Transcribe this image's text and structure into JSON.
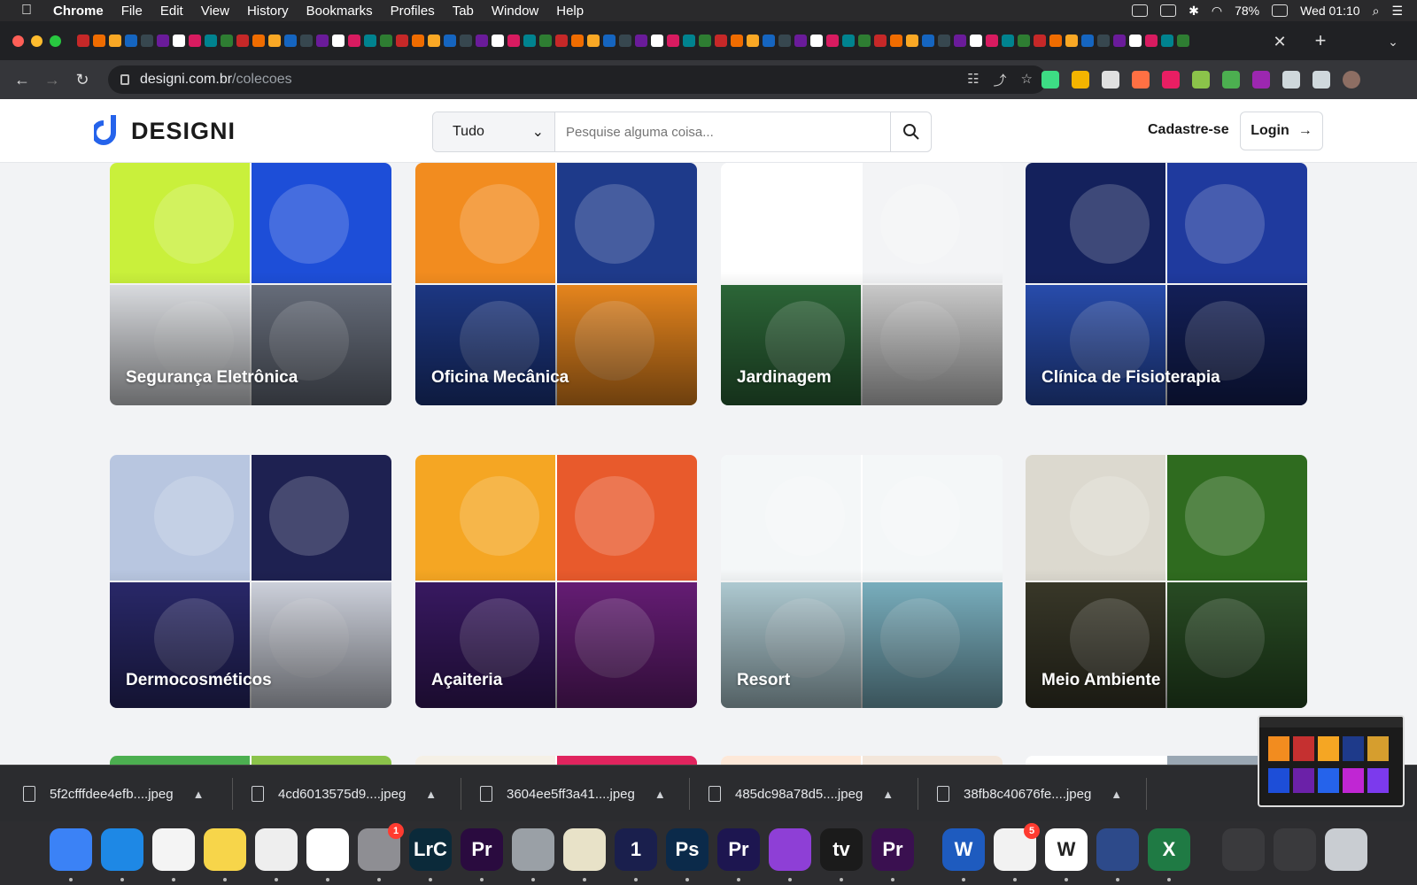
{
  "menubar": {
    "app": "Chrome",
    "items": [
      "File",
      "Edit",
      "View",
      "History",
      "Bookmarks",
      "Profiles",
      "Tab",
      "Window",
      "Help"
    ],
    "battery": "78%",
    "clock": "Wed 01:10"
  },
  "browser": {
    "url_host": "designi.com.br",
    "url_path": "/colecoes",
    "tab_close": "✕",
    "tab_new": "+",
    "tab_menu": "⌄"
  },
  "site": {
    "logo_text": "DESIGNI",
    "search_category": "Tudo",
    "search_placeholder": "Pesquise alguma coisa...",
    "signup_label": "Cadastre-se",
    "login_label": "Login"
  },
  "collections": [
    {
      "title": "Segurança Eletrônica",
      "colors": [
        "#c9f03b",
        "#1d4ed8",
        "#e5e7eb",
        "#6b7280"
      ]
    },
    {
      "title": "Oficina Mecânica",
      "colors": [
        "#f28c1f",
        "#1e3a8a",
        "#1e3a8a",
        "#f28c1f"
      ]
    },
    {
      "title": "Jardinagem",
      "colors": [
        "#ffffff",
        "#f3f4f6",
        "#2e6b3a",
        "#d4d4d4"
      ]
    },
    {
      "title": "Clínica de Fisioterapia",
      "colors": [
        "#14215c",
        "#1f3a9e",
        "#2a50b5",
        "#14215c"
      ]
    },
    {
      "title": "Dermocosméticos",
      "colors": [
        "#b8c6e0",
        "#1e2151",
        "#2b2a6e",
        "#d7dbe6"
      ]
    },
    {
      "title": "Açaiteria",
      "colors": [
        "#f5a623",
        "#e85a2c",
        "#3b1a66",
        "#6a1e7a"
      ]
    },
    {
      "title": "Resort",
      "colors": [
        "#f4f7f8",
        "#f4f7f8",
        "#b7d4dc",
        "#7fb7c7"
      ]
    },
    {
      "title": "Meio Ambiente",
      "colors": [
        "#dcd9cf",
        "#2f6b1f",
        "#3b3a2a",
        "#2a4f25"
      ]
    }
  ],
  "downloads": [
    "5f2cfffdee4efb....jpeg",
    "4cd6013575d9....jpeg",
    "3604ee5ff3a41....jpeg",
    "485dc98a78d5....jpeg",
    "38fb8c40676fe....jpeg"
  ],
  "dock": {
    "apps": [
      {
        "name": "Finder",
        "label": "",
        "color": "#3b82f6"
      },
      {
        "name": "Safari",
        "label": "",
        "color": "#1e88e5"
      },
      {
        "name": "Chrome",
        "label": "",
        "color": "#f4f4f4"
      },
      {
        "name": "Notes",
        "label": "",
        "color": "#f7d54a"
      },
      {
        "name": "TextEdit",
        "label": "",
        "color": "#eeeeee"
      },
      {
        "name": "Photos",
        "label": "",
        "color": "#ffffff"
      },
      {
        "name": "System Preferences",
        "label": "",
        "color": "#8e8e93",
        "badge": "1"
      },
      {
        "name": "Lightroom Classic",
        "label": "LrC",
        "color": "#0b2a3a"
      },
      {
        "name": "Premiere Pro",
        "label": "Pr",
        "color": "#2a0b3f"
      },
      {
        "name": "Blocked App",
        "label": "",
        "color": "#9aa0a6"
      },
      {
        "name": "Preview",
        "label": "",
        "color": "#e8e2c8"
      },
      {
        "name": "1Password",
        "label": "1",
        "color": "#1a1f4d"
      },
      {
        "name": "Photoshop",
        "label": "Ps",
        "color": "#0b2a4a"
      },
      {
        "name": "Premiere Pro 2",
        "label": "Pr",
        "color": "#1d1650"
      },
      {
        "name": "Podcasts",
        "label": "",
        "color": "#8e3fd6"
      },
      {
        "name": "Apple TV",
        "label": "tv",
        "color": "#1b1b1b"
      },
      {
        "name": "Premiere Pro 3",
        "label": "Pr",
        "color": "#3a1050"
      },
      {
        "name": "Word",
        "label": "W",
        "color": "#1e5bbf"
      },
      {
        "name": "Microsoft Store",
        "label": "",
        "color": "#f2f2f2",
        "badge": "5"
      },
      {
        "name": "Wondershare",
        "label": "W",
        "color": "#ffffff"
      },
      {
        "name": "Fantastical",
        "label": "",
        "color": "#2d4a8a"
      },
      {
        "name": "Excel",
        "label": "X",
        "color": "#1f7a44"
      },
      {
        "name": "Downloads Stack",
        "label": "",
        "color": "#3a3a3d"
      },
      {
        "name": "Documents Stack",
        "label": "",
        "color": "#3a3a3d"
      },
      {
        "name": "Trash",
        "label": "",
        "color": "#c9cdd2"
      }
    ]
  }
}
